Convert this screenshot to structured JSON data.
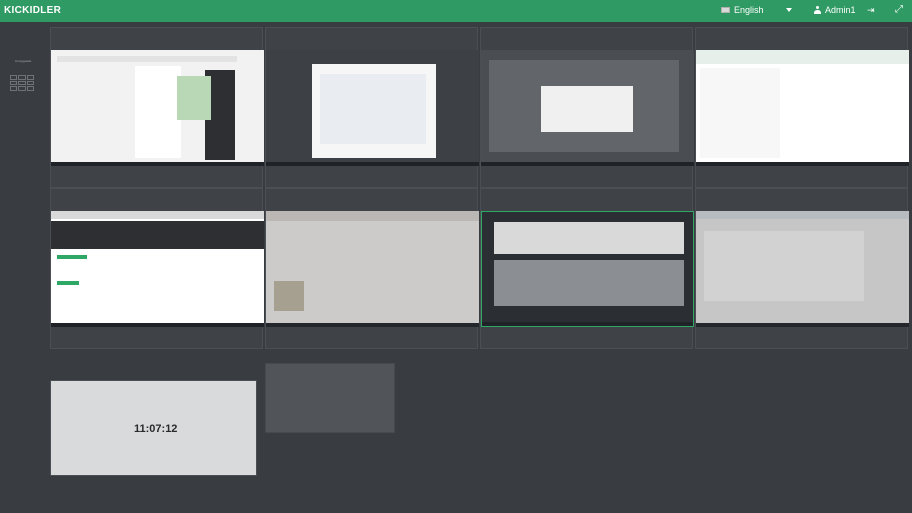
{
  "app": {
    "logo": "KICKIDLER"
  },
  "topbar": {
    "language": "English",
    "user": "Admin1",
    "logout_icon": "logout-icon",
    "fullscreen_icon": "expand-icon"
  },
  "sidebar": {
    "label": "Сотрудники",
    "grid_icon": "grid-icon"
  },
  "tiles": [
    {
      "title": "",
      "status1": "",
      "status2": ""
    },
    {
      "title": "",
      "status1": "",
      "status2": ""
    },
    {
      "title": "",
      "status1": "",
      "status2": ""
    },
    {
      "title": "",
      "status1": "",
      "status2": ""
    },
    {
      "title": "",
      "status1": "",
      "status2": ""
    },
    {
      "title": "",
      "status1": "",
      "status2": ""
    },
    {
      "title": "",
      "status1": "",
      "status2": ""
    },
    {
      "title": "",
      "status1": "",
      "status2": ""
    }
  ],
  "bottom_tile": {
    "title": "",
    "clock": "11:07:12"
  },
  "colors": {
    "topbar": "#2f9a63",
    "background": "#393c40"
  }
}
